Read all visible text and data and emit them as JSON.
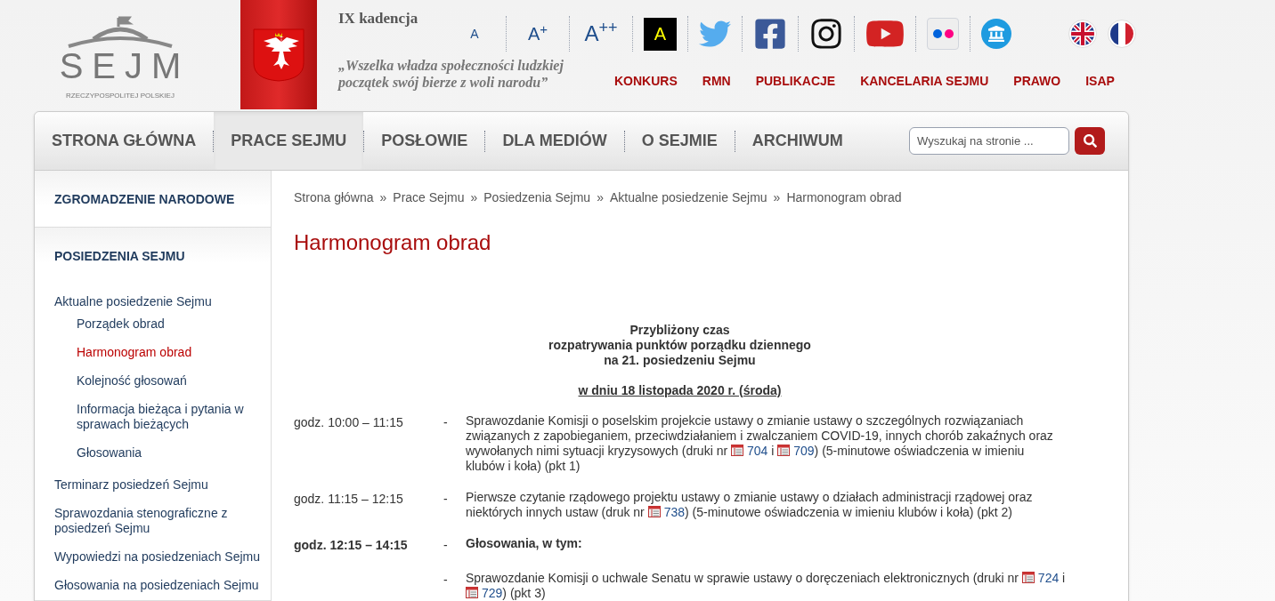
{
  "logo": {
    "name": "SEJM",
    "subtitle": "RZECZYPOSPOLITEJ POLSKIEJ"
  },
  "term": "IX kadencja",
  "motto": [
    "„Wszelka władza społeczności ludzkiej",
    "początek swój bierze z woli narodu”"
  ],
  "font_sizes": [
    {
      "label": "A",
      "kind": "small"
    },
    {
      "label": "A$^{+}$",
      "kind": "medium"
    },
    {
      "label": "A$^{++}$",
      "kind": "large"
    }
  ],
  "contrast_button": "A",
  "top_links": [
    "KONKURS",
    "RMN",
    "PUBLIKACJE",
    "KANCELARIA SEJMU",
    "PRAWO",
    "ISAP"
  ],
  "nav": [
    {
      "label": "STRONA GŁÓWNA",
      "selected": false
    },
    {
      "label": "PRACE SEJMU",
      "selected": true
    },
    {
      "label": "POSŁOWIE",
      "selected": false
    },
    {
      "label": "DLA MEDIÓW",
      "selected": false
    },
    {
      "label": "O SEJMIE",
      "selected": false
    },
    {
      "label": "ARCHIWUM",
      "selected": false
    }
  ],
  "search": {
    "placeholder": "Wyszukaj na stronie ..."
  },
  "sidebar": {
    "sections": [
      {
        "heading": "ZGROMADZENIE NARODOWE"
      },
      {
        "heading": "POSIEDZENIA SEJMU",
        "items": [
          {
            "label": "Aktualne posiedzenie Sejmu",
            "selected": false,
            "children": [
              {
                "label": "Porządek obrad",
                "selected": false
              },
              {
                "label": "Harmonogram obrad",
                "selected": true
              },
              {
                "label": "Kolejność głosowań",
                "selected": false
              },
              {
                "label": "Informacja bieżąca i pytania w sprawach bieżących",
                "selected": false
              },
              {
                "label": "Głosowania",
                "selected": false
              }
            ]
          },
          {
            "label": "Terminarz posiedzeń Sejmu",
            "selected": false
          },
          {
            "label": "Sprawozdania stenograficzne z posiedzeń Sejmu",
            "selected": false
          },
          {
            "label": "Wypowiedzi na posiedzeniach Sejmu",
            "selected": false
          },
          {
            "label": "Głosowania na posiedzeniach Sejmu",
            "selected": false
          }
        ]
      }
    ]
  },
  "breadcrumbs": [
    "Strona główna",
    "Prace Sejmu",
    "Posiedzenia Sejmu",
    "Aktualne posiedzenie Sejmu",
    "Harmonogram obrad"
  ],
  "breadcrumb_separator": "»",
  "page_title": "Harmonogram obrad",
  "schedule_heading": [
    "Przybliżony czas",
    "rozpatrywania punktów porządku dziennego",
    "na 21. posiedzeniu Sejmu"
  ],
  "schedule_date": "w dniu 18 listopada 2020 r. (środa)",
  "agenda": [
    {
      "time": "godz. 10:00 – 11:15",
      "dash": "-",
      "bold": false,
      "parts": [
        {
          "kind": "text",
          "text": "Sprawozdanie Komisji o poselskim projekcie ustawy o zmianie ustawy o szczególnych rozwiązaniach związanych z zapobieganiem, przeciwdziałaniem i zwalczaniem COVID-19, innych chorób zakaźnych oraz wywołanych nimi sytuacji kryzysowych (druki nr "
        },
        {
          "kind": "print",
          "text": "704"
        },
        {
          "kind": "text",
          "text": " i "
        },
        {
          "kind": "print",
          "text": "709"
        },
        {
          "kind": "text",
          "text": ") (5-minutowe oświadczenia w imieniu klubów i koła) (pkt 1)"
        }
      ]
    },
    {
      "time": "godz. 11:15 – 12:15",
      "dash": "-",
      "bold": false,
      "parts": [
        {
          "kind": "text",
          "text": "Pierwsze czytanie rządowego projektu ustawy o zmianie ustawy o działach administracji rządowej oraz niektórych innych ustaw (druk nr "
        },
        {
          "kind": "print",
          "text": "738"
        },
        {
          "kind": "text",
          "text": ") (5-minutowe oświadczenia w imieniu klubów i koła) (pkt 2)"
        }
      ]
    },
    {
      "time": "godz. 12:15 – 14:15",
      "dash": "-",
      "bold": true,
      "parts": [
        {
          "kind": "text",
          "text": "Głosowania, w tym:"
        }
      ]
    },
    {
      "dash": "-",
      "bold": false,
      "parts": [
        {
          "kind": "text",
          "text": "Sprawozdanie Komisji o uchwale Senatu w sprawie ustawy o doręczeniach elektronicznych (druki nr "
        },
        {
          "kind": "print",
          "text": "724"
        },
        {
          "kind": "text",
          "text": " i "
        },
        {
          "kind": "print",
          "text": "729"
        },
        {
          "kind": "text",
          "text": ") (pkt 3)"
        }
      ]
    }
  ]
}
